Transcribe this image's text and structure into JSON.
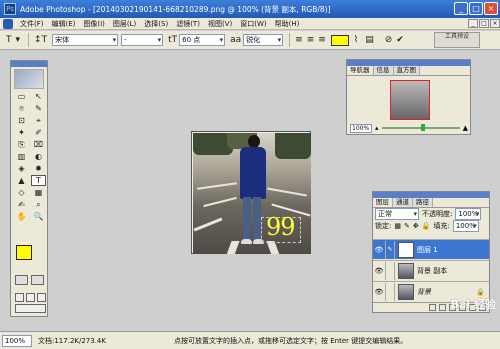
{
  "titlebar": {
    "app_icon": "Ps",
    "title": "Adobe Photoshop - [20140302190141-668210289.png @ 100% (背景 副本, RGB/8)]",
    "minimize": "_",
    "maximize": "□",
    "close": "×"
  },
  "menu": {
    "items": [
      "文件(F)",
      "编辑(E)",
      "图像(I)",
      "图层(L)",
      "选择(S)",
      "滤镜(T)",
      "视图(V)",
      "窗口(W)",
      "帮助(H)"
    ],
    "doc_controls": [
      "_",
      "□",
      "×"
    ]
  },
  "options": {
    "tool_icon": "T",
    "font_family": "宋体",
    "font_style": "-",
    "size_icon": "tT",
    "font_size": "60 点",
    "aa_icon": "aa",
    "antialias": "锐化",
    "text_color": "#ffff00",
    "palette_well": "工具预设"
  },
  "toolbox": {
    "tools": [
      "▭",
      "↖",
      "⌾",
      "✎",
      "⊡",
      "⌖",
      "✦",
      "✐",
      "⎘",
      "⌧",
      "▥",
      "◐",
      "◈",
      "✹",
      "▲",
      "T",
      "◇",
      "▦",
      "✍",
      "⌕",
      "✋",
      "🔍"
    ],
    "active_index": 15,
    "foreground": "#ffff00",
    "background": "#ffffff"
  },
  "document": {
    "overlay_text": "99"
  },
  "navigator": {
    "tabs": [
      "导航器",
      "信息",
      "直方图"
    ],
    "zoom": "100%"
  },
  "layers": {
    "tabs": [
      "图层",
      "通道",
      "路径"
    ],
    "blend_mode": "正常",
    "opacity_label": "不透明度:",
    "opacity": "100%",
    "lock_label": "锁定:",
    "fill_label": "填充:",
    "fill": "100%",
    "items": [
      {
        "name": "图层 1",
        "type": "text",
        "glyph": "T"
      },
      {
        "name": "背景 副本",
        "type": "image"
      },
      {
        "name": "背景",
        "type": "image",
        "lock": "🔒"
      }
    ]
  },
  "status": {
    "zoom": "100%",
    "doc": "文档:117.2K/273.4K",
    "message": "点按可放置文字的插入点，或拖移可选定文字；按 Enter 键提交编辑结果。"
  },
  "watermark": "Bai 经验"
}
